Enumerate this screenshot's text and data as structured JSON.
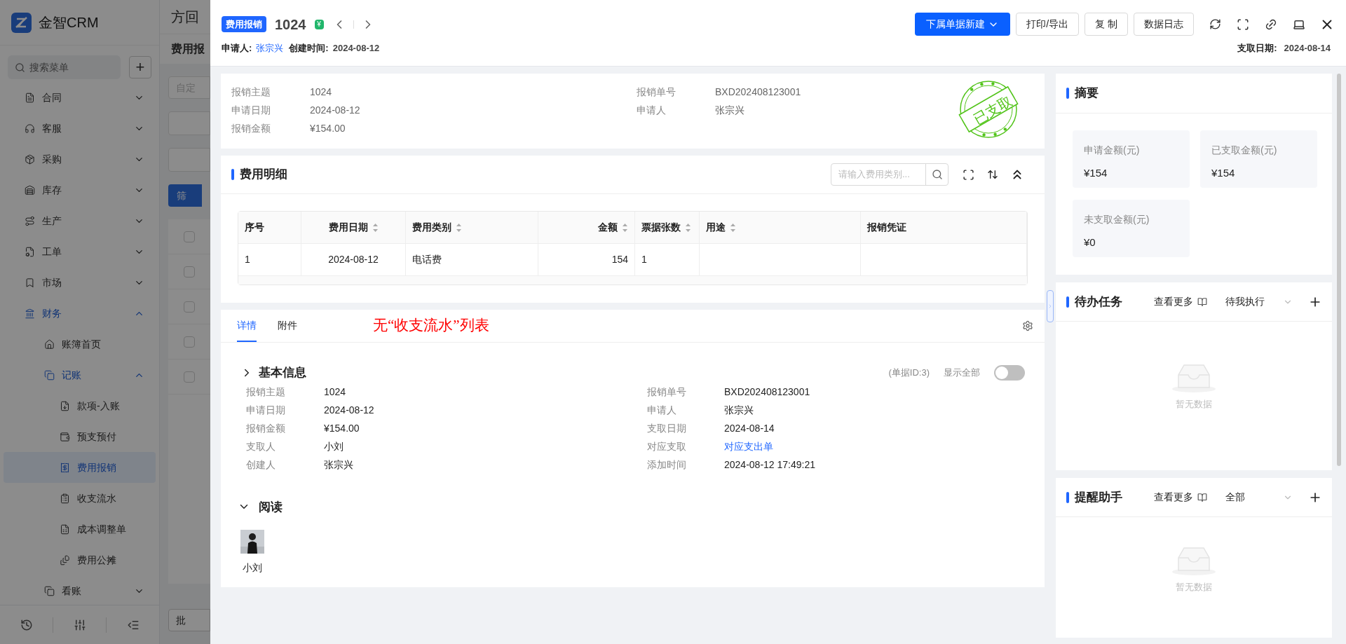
{
  "background_app": {
    "logo_text": "金智CRM",
    "tab_title": "方回",
    "search_placeholder": "搜索菜单",
    "add_button": "+",
    "menu": [
      {
        "label": "合同",
        "expanded": false,
        "selected": false
      },
      {
        "label": "客服",
        "expanded": false,
        "selected": false
      },
      {
        "label": "采购",
        "expanded": false,
        "selected": false
      },
      {
        "label": "库存",
        "expanded": false,
        "selected": false
      },
      {
        "label": "生产",
        "expanded": false,
        "selected": false
      },
      {
        "label": "工单",
        "expanded": false,
        "selected": false
      },
      {
        "label": "市场",
        "expanded": false,
        "selected": false
      },
      {
        "label": "财务",
        "expanded": true,
        "selected": false,
        "children": [
          {
            "label": "账簿首页",
            "selected": false
          },
          {
            "label": "记账",
            "expanded": true,
            "selected": false,
            "children": [
              {
                "label": "款项-入账",
                "selected": false
              },
              {
                "label": "预支预付",
                "selected": false
              },
              {
                "label": "费用报销",
                "selected": true
              },
              {
                "label": "收支流水",
                "selected": false
              },
              {
                "label": "成本调整单",
                "selected": false
              },
              {
                "label": "费用公摊",
                "selected": false
              }
            ]
          },
          {
            "label": "看账",
            "expanded": false,
            "selected": false
          }
        ]
      }
    ],
    "page_title": "费用报",
    "filter_placeholder": "自定",
    "filter_button": "筛",
    "batch_button": "批",
    "row_checkboxes": [
      {
        "checked": false
      },
      {
        "checked": false
      },
      {
        "checked": false
      },
      {
        "checked": false
      },
      {
        "checked": false
      }
    ]
  },
  "drawer": {
    "badge": "费用报销",
    "title": "1024",
    "currency_mark": "¥",
    "applicant_label": "申请人:",
    "applicant": "张宗兴",
    "created_label": "创建时间:",
    "created": "2024-08-12",
    "buttons": [
      {
        "label": "下属单据新建",
        "kind": "primary"
      },
      {
        "label": "打印/导出",
        "kind": "default"
      },
      {
        "label": "复 制",
        "kind": "default"
      },
      {
        "label": "数据日志",
        "kind": "default"
      }
    ],
    "paid_date_label": "支取日期:",
    "paid_date": "2024-08-14"
  },
  "overview": {
    "left": [
      {
        "label": "报销主题",
        "value": "1024",
        "kind": "text"
      },
      {
        "label": "申请日期",
        "value": "2024-08-12",
        "kind": "text"
      },
      {
        "label": "报销金额",
        "value": "¥154.00",
        "kind": "text"
      }
    ],
    "right": [
      {
        "label": "报销单号",
        "value": "BXD202408123001",
        "kind": "text"
      },
      {
        "label": "申请人",
        "value": "张宗兴",
        "kind": "text"
      }
    ],
    "stamp": "已支取"
  },
  "expense_details": {
    "title": "费用明细",
    "search_placeholder": "请输入费用类别...",
    "table": {
      "columns": [
        {
          "label": "序号",
          "sortable": false
        },
        {
          "label": "费用日期",
          "sortable": true
        },
        {
          "label": "费用类别",
          "sortable": true
        },
        {
          "label": "金额",
          "sortable": true
        },
        {
          "label": "票据张数",
          "sortable": true
        },
        {
          "label": "用途",
          "sortable": true
        },
        {
          "label": "报销凭证",
          "sortable": false
        }
      ],
      "rows": [
        {
          "cells": [
            "1",
            "2024-08-12",
            "电话费",
            "154",
            "1"
          ]
        }
      ]
    }
  },
  "tabs": [
    {
      "label": "详情",
      "selected": true
    },
    {
      "label": "附件",
      "selected": false
    }
  ],
  "annotation": "无“收支流水”列表",
  "details": {
    "sections": [
      {
        "title": "基本信息",
        "expanded": false
      },
      {
        "title": "阅读",
        "expanded": true
      }
    ],
    "record_id": "(单据ID:3)",
    "show_all": {
      "label": "显示全部",
      "on": false
    },
    "left": [
      {
        "label": "报销主题",
        "value": "1024",
        "kind": "text"
      },
      {
        "label": "申请日期",
        "value": "2024-08-12",
        "kind": "text"
      },
      {
        "label": "报销金额",
        "value": "¥154.00",
        "kind": "text"
      },
      {
        "label": "支取人",
        "value": "小刘",
        "kind": "text"
      },
      {
        "label": "创建人",
        "value": "张宗兴",
        "kind": "text"
      }
    ],
    "right": [
      {
        "label": "报销单号",
        "value": "BXD202408123001",
        "kind": "text"
      },
      {
        "label": "申请人",
        "value": "张宗兴",
        "kind": "text"
      },
      {
        "label": "支取日期",
        "value": "2024-08-14",
        "kind": "text"
      },
      {
        "label": "对应支取",
        "value": "对应支出单",
        "kind": "link"
      },
      {
        "label": "添加时间",
        "value": "2024-08-12 17:49:21",
        "kind": "text"
      }
    ],
    "readers": [
      {
        "name": "小刘"
      }
    ]
  },
  "summary": {
    "title": "摘要",
    "stats": [
      {
        "label": "申请金额(元)",
        "value": "¥154"
      },
      {
        "label": "已支取金额(元)",
        "value": "¥154"
      },
      {
        "label": "未支取金额(元)",
        "value": "¥0"
      }
    ]
  },
  "todo": {
    "title": "待办任务",
    "more": "查看更多",
    "filter": "待我执行",
    "empty": "暂无数据"
  },
  "reminders": {
    "title": "提醒助手",
    "more": "查看更多",
    "filter": "全部",
    "empty": "暂无数据"
  }
}
